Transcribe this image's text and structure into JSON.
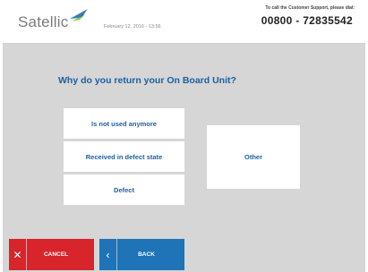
{
  "header": {
    "brand": "Satellic",
    "datetime": "February 12, 2016 - 13:56",
    "support_label": "To call the Customer Support, please dial:",
    "support_number": "00800 - 72835542"
  },
  "main": {
    "question": "Why do you return your On Board Unit?",
    "options": [
      {
        "label": "Is not used anymore"
      },
      {
        "label": "Received in defect state"
      },
      {
        "label": "Defect"
      },
      {
        "label": "Other"
      }
    ]
  },
  "footer": {
    "cancel_label": "CANCEL",
    "back_label": "BACK",
    "cancel_icon": "close-icon",
    "back_icon": "chevron-left-icon"
  },
  "colors": {
    "accent_blue": "#1d5fa0",
    "cancel_red": "#d8242b",
    "back_blue": "#1f73b7",
    "background_gray": "#d6d6d6"
  }
}
